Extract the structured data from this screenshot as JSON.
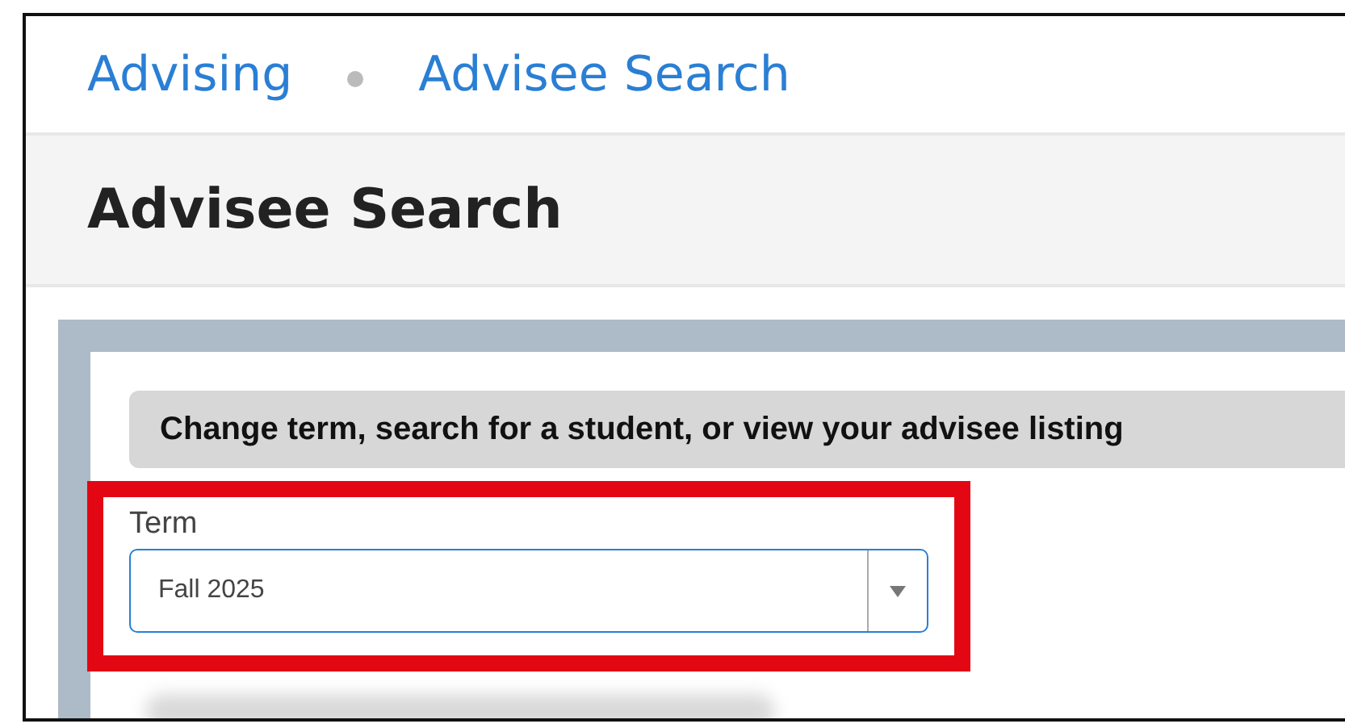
{
  "breadcrumbs": [
    {
      "label": "Advising"
    },
    {
      "label": "Advisee Search"
    }
  ],
  "page_title": "Advisee Search",
  "section": {
    "heading": "Change term, search for a student, or view your advisee listing",
    "term": {
      "label": "Term",
      "value": "Fall 2025"
    }
  }
}
